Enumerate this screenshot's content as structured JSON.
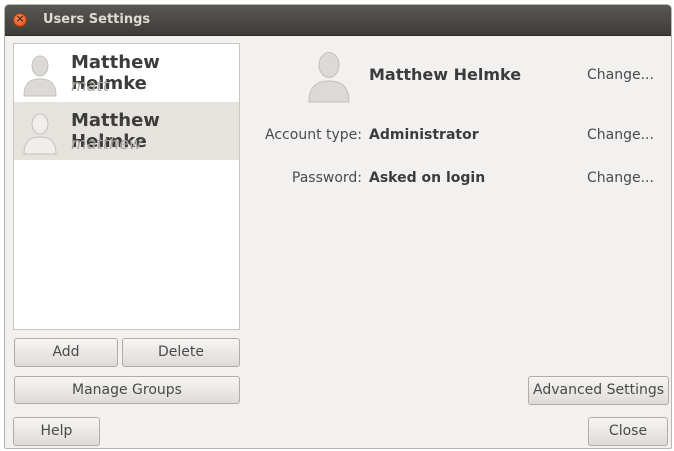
{
  "window": {
    "title": "Users Settings",
    "close_glyph": "×"
  },
  "users": [
    {
      "name": "Matthew Helmke",
      "login": "matt"
    },
    {
      "name": "Matthew Helmke",
      "login": "matthew"
    }
  ],
  "buttons": {
    "add": "Add",
    "delete": "Delete",
    "manage_groups": "Manage Groups",
    "help": "Help",
    "advanced_settings": "Advanced Settings",
    "close": "Close"
  },
  "details": {
    "name": "Matthew Helmke",
    "account_type_label": "Account type:",
    "account_type_value": "Administrator",
    "password_label": "Password:",
    "password_value": "Asked on login",
    "change_label": "Change..."
  },
  "colors": {
    "selected_row": "#e6e3df",
    "titlebar": "#3d3c38",
    "close_button": "#e25a21"
  },
  "icons": {
    "avatar": "user-silhouette-icon",
    "close": "close-icon"
  }
}
